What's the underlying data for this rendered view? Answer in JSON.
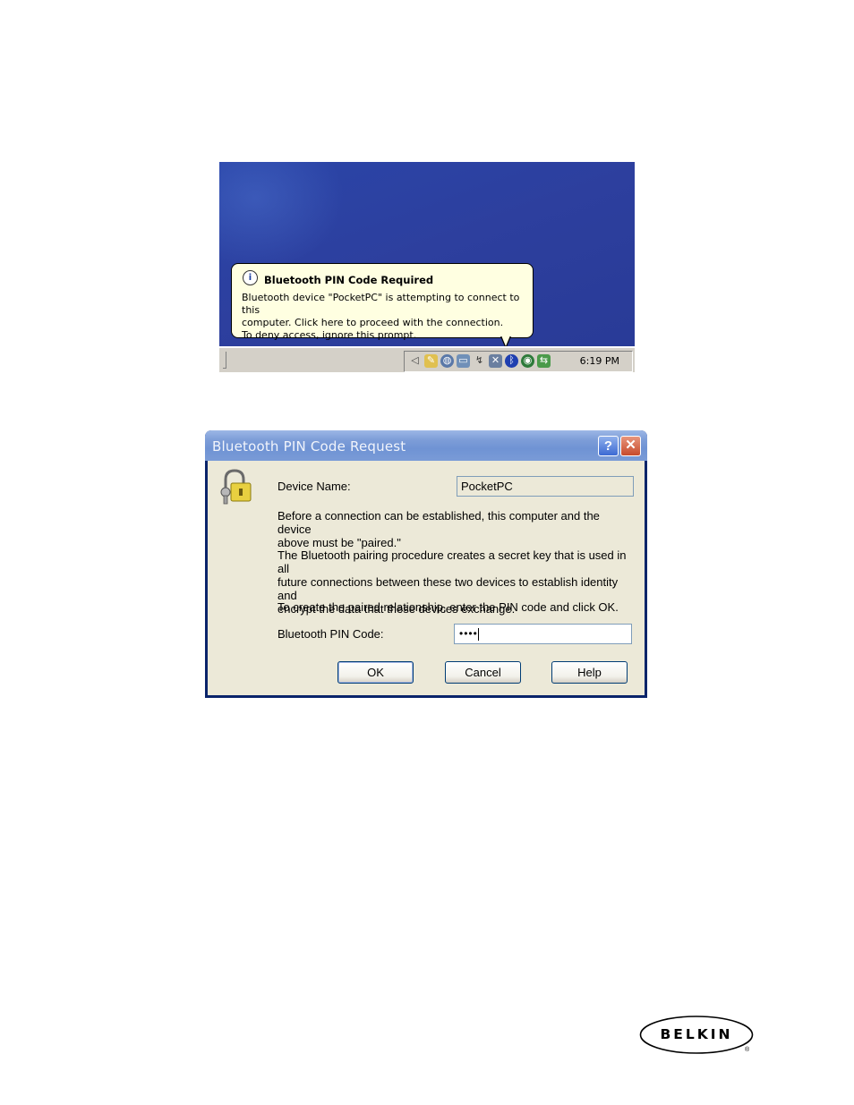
{
  "balloon": {
    "title": "Bluetooth PIN Code Required",
    "line1": "Bluetooth device \"PocketPC\" is attempting to connect to this",
    "line2": "computer.  Click here to proceed with the connection.",
    "line3": "To deny access, ignore this prompt."
  },
  "taskbar": {
    "clock": "6:19 PM",
    "tray_icons": [
      "volume-icon",
      "pen-icon",
      "network-globe-icon",
      "display-icon",
      "connection-icon",
      "network-disconnected-icon",
      "bluetooth-icon",
      "update-icon",
      "safely-remove-icon"
    ]
  },
  "dialog": {
    "title": "Bluetooth PIN Code Request",
    "device_name_label": "Device Name:",
    "device_name_value": "PocketPC",
    "para1_line1": "Before a connection can be established, this computer and the device",
    "para1_line2": "above must be \"paired.\"",
    "para2_line1": "The Bluetooth pairing procedure creates a secret key that is used in all",
    "para2_line2": "future connections between these two devices to establish identity and",
    "para2_line3": "encrypt the data that these devices exchange.",
    "para3": "To create the paired relationship, enter the PIN code and click OK.",
    "pin_label": "Bluetooth PIN Code:",
    "pin_value": "••••",
    "ok_label": "OK",
    "cancel_label": "Cancel",
    "help_label": "Help"
  },
  "logo": {
    "text": "BELKIN",
    "reg_mark": "®"
  }
}
